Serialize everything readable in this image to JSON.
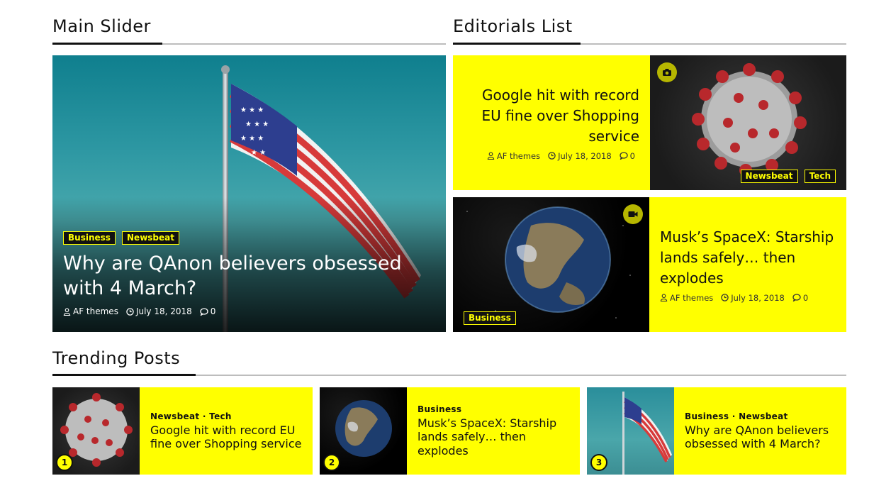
{
  "sections": {
    "main_slider": "Main Slider",
    "editorials": "Editorials List",
    "trending": "Trending Posts"
  },
  "slider": {
    "tags": [
      "Business",
      "Newsbeat"
    ],
    "headline": "Why are QAnon believers obsessed with 4 March?",
    "author": "AF themes",
    "date": "July 18, 2018",
    "comments": "0"
  },
  "editorials": [
    {
      "headline": "Google hit with record EU fine over Shopping service",
      "author": "AF themes",
      "date": "July 18, 2018",
      "comments": "0",
      "tags": [
        "Newsbeat",
        "Tech"
      ],
      "media_icon": "camera-icon"
    },
    {
      "headline": "Musk’s SpaceX: Starship lands safely… then explodes",
      "author": "AF themes",
      "date": "July 18, 2018",
      "comments": "0",
      "tags": [
        "Business"
      ],
      "media_icon": "video-camera-icon"
    }
  ],
  "trending": [
    {
      "rank": "1",
      "cats": "Newsbeat · Tech",
      "title": "Google hit with record EU fine over Shopping service"
    },
    {
      "rank": "2",
      "cats": "Business",
      "title": "Musk’s SpaceX: Starship lands safely… then explodes"
    },
    {
      "rank": "3",
      "cats": "Business · Newsbeat",
      "title": "Why are QAnon believers obsessed with 4 March?"
    }
  ],
  "colors": {
    "accent": "#ffff00",
    "badge": "#b6b600",
    "text": "#111111"
  }
}
